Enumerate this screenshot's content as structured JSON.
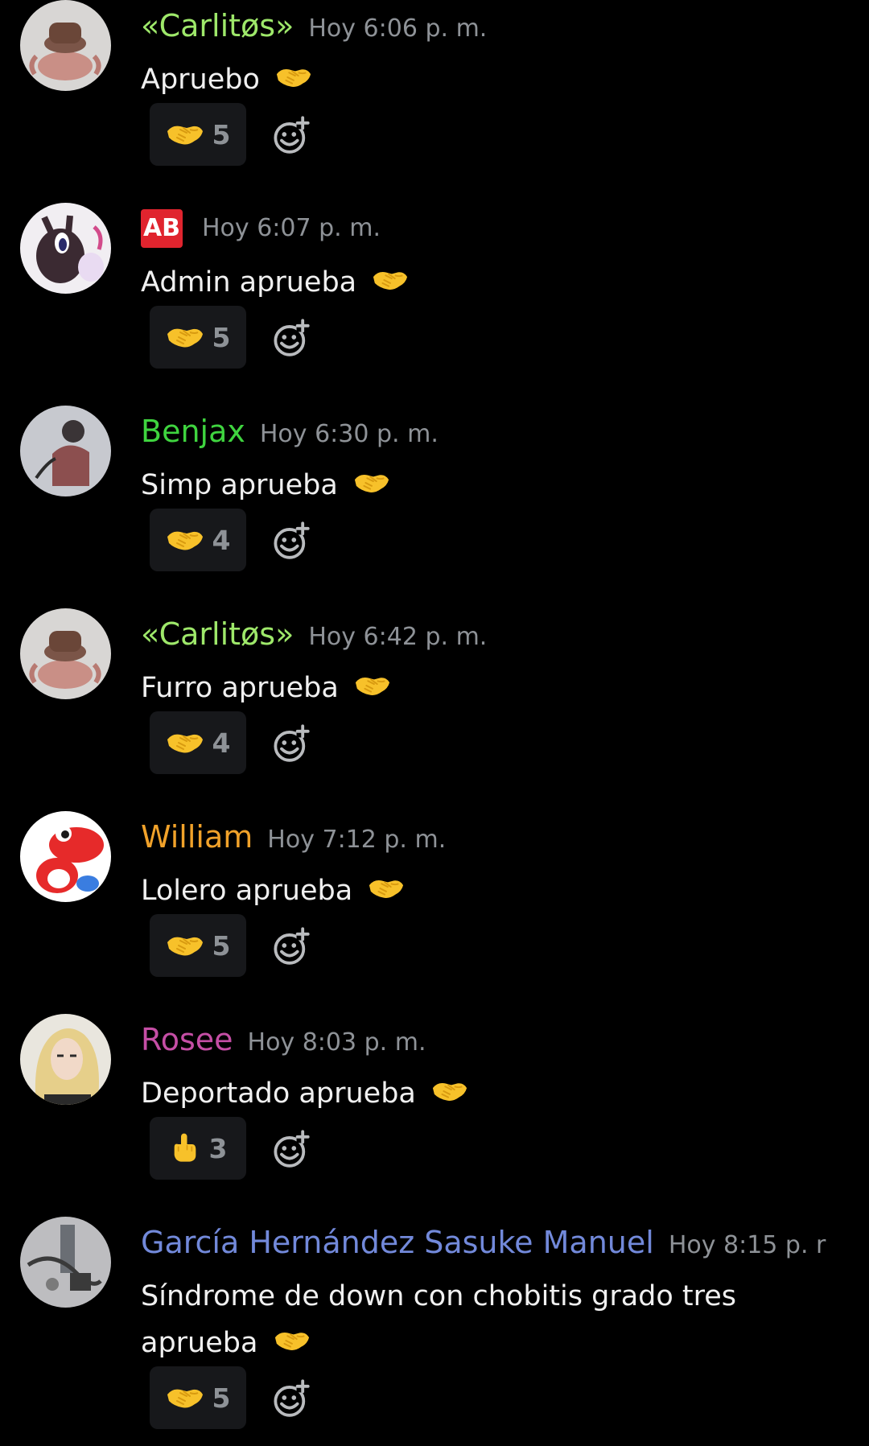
{
  "messages": [
    {
      "author": "«Carlitøs»",
      "author_color": "#9ee86a",
      "timestamp": "Hoy 6:06 p. m.",
      "text": "Apruebo",
      "avatar_icon": "crab-with-hat-avatar",
      "reaction": {
        "emoji": "handshake",
        "count": "5"
      }
    },
    {
      "author": "",
      "badge": "AB",
      "timestamp": "Hoy 6:07 p. m.",
      "text": "Admin aprueba",
      "avatar_icon": "dark-pony-avatar",
      "reaction": {
        "emoji": "handshake",
        "count": "5"
      }
    },
    {
      "author": "Benjax",
      "author_color": "#3fd43f",
      "timestamp": "Hoy 6:30 p. m.",
      "text": "Simp aprueba",
      "avatar_icon": "sketch-character-avatar",
      "reaction": {
        "emoji": "handshake",
        "count": "4"
      }
    },
    {
      "author": "«Carlitøs»",
      "author_color": "#9ee86a",
      "timestamp": "Hoy 6:42 p. m.",
      "text": "Furro aprueba",
      "avatar_icon": "crab-with-hat-avatar",
      "reaction": {
        "emoji": "handshake",
        "count": "4"
      }
    },
    {
      "author": "William",
      "author_color": "#f1a22a",
      "timestamp": "Hoy 7:12 p. m.",
      "text": "Lolero aprueba",
      "avatar_icon": "red-yoshi-avatar",
      "reaction": {
        "emoji": "handshake",
        "count": "5"
      }
    },
    {
      "author": "Rosee",
      "author_color": "#c54ea5",
      "timestamp": "Hoy 8:03 p. m.",
      "text": "Deportado aprueba",
      "avatar_icon": "blonde-woman-avatar",
      "reaction": {
        "emoji": "middle-finger",
        "count": "3"
      }
    },
    {
      "author": "García Hernández Sasuke Manuel",
      "author_color": "#7289da",
      "timestamp": "Hoy 8:15 p. r",
      "text_line1": "Síndrome de down con chobitis grado tres",
      "text_line2": "aprueba",
      "avatar_icon": "desk-photo-avatar",
      "reaction": {
        "emoji": "handshake",
        "count": "5"
      }
    }
  ],
  "colors": {
    "background": "#000000",
    "timestamp": "#8e9297",
    "reaction_bg": "#17181b",
    "emoji_yellow": "#f7c12a"
  }
}
